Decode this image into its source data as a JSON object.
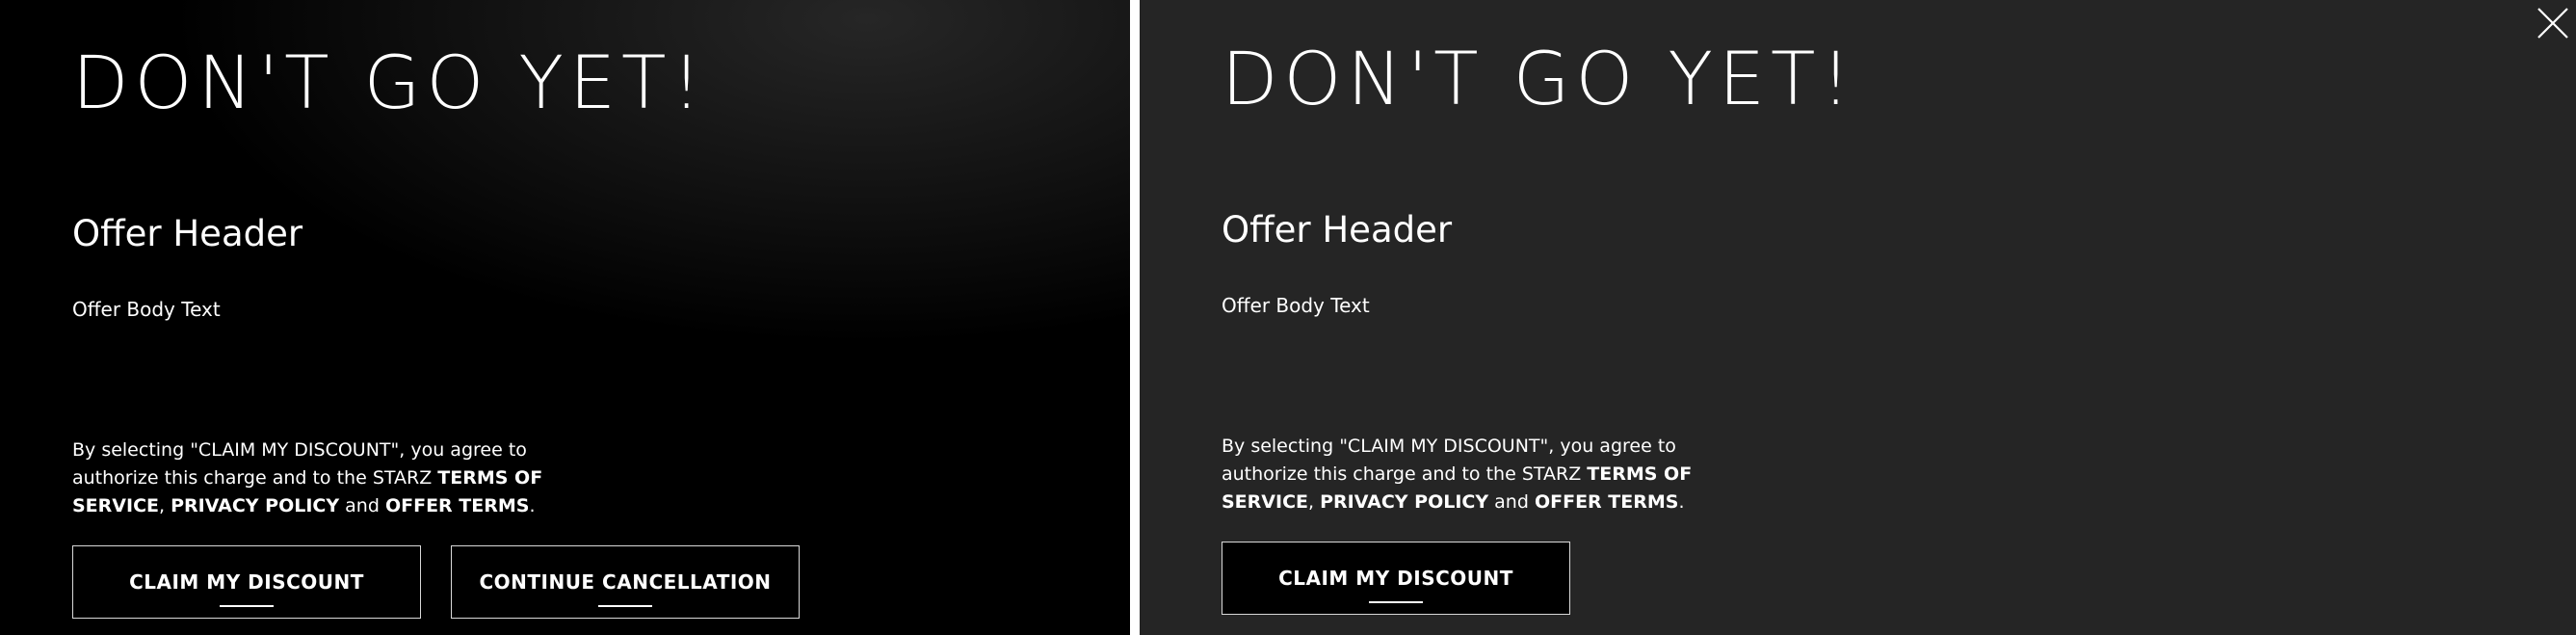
{
  "left_panel": {
    "headline": "DON'T GO YET!",
    "offer_header": "Offer Header",
    "offer_body": "Offer Body Text",
    "legal": {
      "intro": "By selecting \"CLAIM MY DISCOUNT\", you agree to authorize this charge and to the STARZ ",
      "terms_of_service": "TERMS OF SERVICE",
      "sep": ", ",
      "privacy_policy": "PRIVACY POLICY",
      "and": " and ",
      "offer_terms": "OFFER TERMS",
      "end": "."
    },
    "claim_button": "CLAIM MY DISCOUNT",
    "continue_button": "CONTINUE CANCELLATION"
  },
  "right_panel": {
    "headline": "DON'T GO YET!",
    "offer_header": "Offer Header",
    "offer_body": "Offer Body Text",
    "legal": {
      "intro": "By selecting \"CLAIM MY DISCOUNT\", you agree to authorize this charge and to the STARZ ",
      "terms_of_service": "TERMS OF SERVICE",
      "sep": ", ",
      "privacy_policy": "PRIVACY POLICY",
      "and": " and ",
      "offer_terms": "OFFER TERMS",
      "end": "."
    },
    "claim_button": "CLAIM MY DISCOUNT",
    "close_icon": "close-icon"
  },
  "colors": {
    "text": "#ffffff",
    "left_background": "#000000",
    "right_background": "#252525",
    "button_border": "#d8d8d8",
    "divider": "#ffffff"
  }
}
